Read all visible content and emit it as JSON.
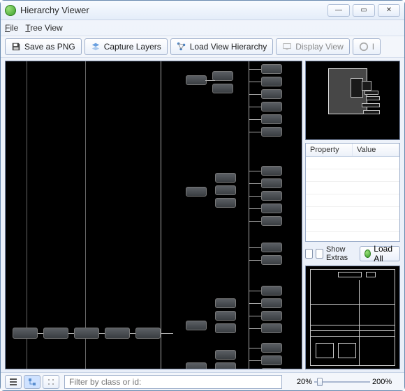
{
  "title": "Hierarchy Viewer",
  "menu": {
    "file": "File",
    "tree_view": "Tree View"
  },
  "toolbar": {
    "save_png": "Save as PNG",
    "capture_layers": "Capture Layers",
    "load_hierarchy": "Load View Hierarchy",
    "display_view": "Display View",
    "invalidate": "I"
  },
  "properties": {
    "col_property": "Property",
    "col_value": "Value"
  },
  "extras": {
    "show_extras": "Show Extras",
    "load_all": "Load All"
  },
  "status": {
    "filter_placeholder": "Filter by class or id:",
    "zoom_left": "20%",
    "zoom_right": "200%"
  }
}
